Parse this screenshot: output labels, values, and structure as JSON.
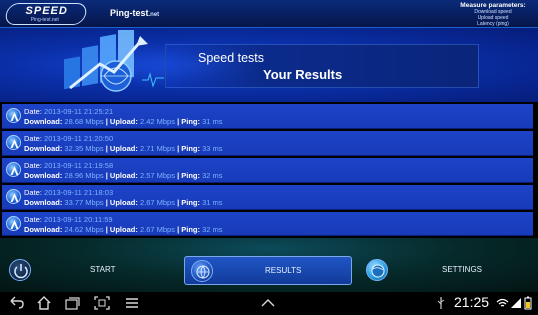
{
  "header": {
    "logo_main": "SPEED",
    "logo_sub": "Ping-test.net",
    "site_name": "Ping-test",
    "site_tld": ".net",
    "measure_title": "Measure parameters:",
    "measure_lines": [
      "Download speed",
      "Upload speed",
      "Latency (ping)"
    ]
  },
  "hero": {
    "line1": "Speed tests",
    "line2": "Your Results"
  },
  "labels": {
    "date": "Date:",
    "download": "Download:",
    "upload": "Upload:",
    "ping": "Ping:",
    "separator": "|"
  },
  "results": [
    {
      "date": "2013-09-11 21:25:21",
      "download": "28.68 Mbps",
      "upload": "2.42 Mbps",
      "ping": "31 ms"
    },
    {
      "date": "2013-09-11 21:20:50",
      "download": "32.35 Mbps",
      "upload": "2.71 Mbps",
      "ping": "33 ms"
    },
    {
      "date": "2013-09-11 21:19:58",
      "download": "28.96 Mbps",
      "upload": "2.57 Mbps",
      "ping": "32 ms"
    },
    {
      "date": "2013-09-11 21:18:03",
      "download": "33.77 Mbps",
      "upload": "2.67 Mbps",
      "ping": "31 ms"
    },
    {
      "date": "2013-09-11 20:11:59",
      "download": "24.62 Mbps",
      "upload": "2.67 Mbps",
      "ping": "32 ms"
    }
  ],
  "nav": {
    "start": "START",
    "results": "RESULTS",
    "settings": "SETTINGS",
    "active": "results"
  },
  "system_bar": {
    "time": "21:25",
    "icons": [
      "back-icon",
      "home-icon",
      "recent-apps-icon",
      "screenshot-icon",
      "menu-icon",
      "chevron-up-icon",
      "usb-icon",
      "wifi-icon",
      "signal-icon",
      "battery-icon"
    ]
  },
  "colors": {
    "accent": "#1d43c8",
    "value_text": "#7fb2ff",
    "header_bg": "#0a2a7a"
  }
}
